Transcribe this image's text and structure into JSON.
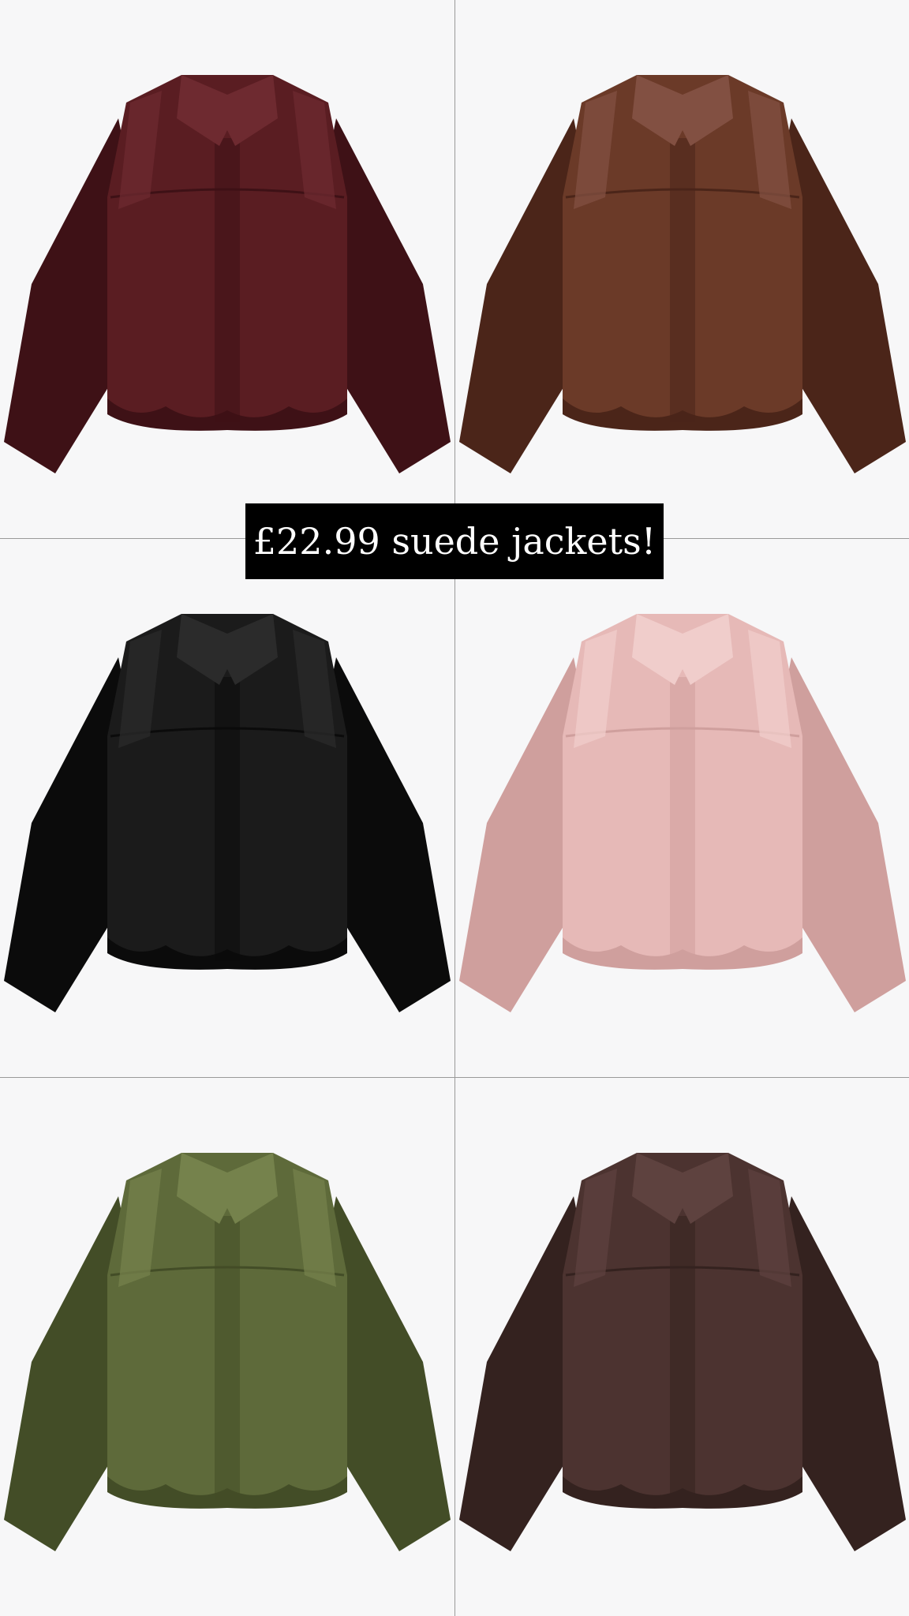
{
  "banner": {
    "text": "£22.99 suede jackets!"
  },
  "jackets": [
    {
      "color_name": "burgundy",
      "main": "#5a1d22",
      "dark": "#3e1116",
      "light": "#6e2a30"
    },
    {
      "color_name": "brown",
      "main": "#6b3a28",
      "dark": "#4b2519",
      "light": "#825042"
    },
    {
      "color_name": "black",
      "main": "#1b1b1b",
      "dark": "#0b0b0b",
      "light": "#2b2b2b"
    },
    {
      "color_name": "pink",
      "main": "#e6b9b7",
      "dark": "#cf9f9d",
      "light": "#f0cdcb"
    },
    {
      "color_name": "olive",
      "main": "#5e6a3a",
      "dark": "#434d27",
      "light": "#75824c"
    },
    {
      "color_name": "chocolate",
      "main": "#4c3330",
      "dark": "#34221f",
      "light": "#5e423f"
    }
  ],
  "colors": {
    "background": "#f7f7f8",
    "divider": "#9a9a9a",
    "banner_bg": "#000000",
    "banner_text": "#ffffff"
  }
}
